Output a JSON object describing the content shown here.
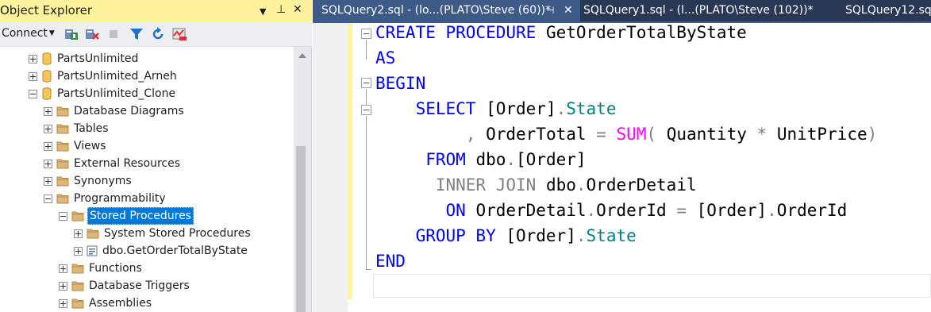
{
  "object_explorer": {
    "title": "Object Explorer",
    "title_controls": {
      "dropdown": "▼",
      "pin": "⊥",
      "close": "✕"
    },
    "toolbar": {
      "connect_label": "Connect",
      "icons": [
        "connect-icon",
        "disconnect-icon",
        "stop-icon",
        "filter-icon",
        "refresh-icon",
        "activity-monitor-icon"
      ]
    },
    "tree": [
      {
        "label": "PartsUnlimited",
        "expander": "plus",
        "icon": "database-icon"
      },
      {
        "label": "PartsUnlimited_Arneh",
        "expander": "plus",
        "icon": "database-icon"
      },
      {
        "label": "PartsUnlimited_Clone",
        "expander": "minus",
        "icon": "database-icon"
      },
      {
        "label": "Database Diagrams",
        "expander": "plus",
        "icon": "folder-icon"
      },
      {
        "label": "Tables",
        "expander": "plus",
        "icon": "folder-icon"
      },
      {
        "label": "Views",
        "expander": "plus",
        "icon": "folder-icon"
      },
      {
        "label": "External Resources",
        "expander": "plus",
        "icon": "folder-icon"
      },
      {
        "label": "Synonyms",
        "expander": "plus",
        "icon": "folder-icon"
      },
      {
        "label": "Programmability",
        "expander": "minus",
        "icon": "folder-icon"
      },
      {
        "label": "Stored Procedures",
        "expander": "minus",
        "icon": "folder-icon",
        "selected": true
      },
      {
        "label": "System Stored Procedures",
        "expander": "plus",
        "icon": "folder-icon"
      },
      {
        "label": "dbo.GetOrderTotalByState",
        "expander": "plus",
        "icon": "stored-procedure-icon"
      },
      {
        "label": "Functions",
        "expander": "plus",
        "icon": "folder-icon"
      },
      {
        "label": "Database Triggers",
        "expander": "plus",
        "icon": "folder-icon"
      },
      {
        "label": "Assemblies",
        "expander": "plus",
        "icon": "folder-icon"
      }
    ]
  },
  "tabs": [
    {
      "label": "SQLQuery2.sql - (lo...(PLATO\\Steve (60))*",
      "active": true,
      "pin": "⊣",
      "close": "✕"
    },
    {
      "label": "SQLQuery1.sql - (l...(PLATO\\Steve (102))*",
      "active": false
    },
    {
      "label": "SQLQuery12.sql",
      "active": false
    }
  ],
  "editor": {
    "lines": [
      [
        {
          "t": "CREATE PROCEDURE",
          "c": "kw"
        },
        {
          "t": " GetOrderTotalByState",
          "c": ""
        }
      ],
      [
        {
          "t": "AS",
          "c": "kw"
        }
      ],
      [
        {
          "t": "BEGIN",
          "c": "kw"
        }
      ],
      [
        {
          "t": "    SELECT",
          "c": "kw"
        },
        {
          "t": " [Order]",
          "c": ""
        },
        {
          "t": ".",
          "c": "gr"
        },
        {
          "t": "State",
          "c": "tl"
        }
      ],
      [
        {
          "t": "         ",
          "c": ""
        },
        {
          "t": ",",
          "c": "gr"
        },
        {
          "t": " OrderTotal ",
          "c": ""
        },
        {
          "t": "=",
          "c": "gr"
        },
        {
          "t": " ",
          "c": ""
        },
        {
          "t": "SUM",
          "c": "fn"
        },
        {
          "t": "(",
          "c": "gr"
        },
        {
          "t": " Quantity ",
          "c": ""
        },
        {
          "t": "*",
          "c": "gr"
        },
        {
          "t": " UnitPrice",
          "c": ""
        },
        {
          "t": ")",
          "c": "gr"
        }
      ],
      [
        {
          "t": "     FROM",
          "c": "kw"
        },
        {
          "t": " dbo",
          "c": ""
        },
        {
          "t": ".",
          "c": "gr"
        },
        {
          "t": "[Order]",
          "c": ""
        }
      ],
      [
        {
          "t": "      INNER JOIN",
          "c": "gr"
        },
        {
          "t": " dbo",
          "c": ""
        },
        {
          "t": ".",
          "c": "gr"
        },
        {
          "t": "OrderDetail",
          "c": ""
        }
      ],
      [
        {
          "t": "       ON",
          "c": "kw"
        },
        {
          "t": " OrderDetail",
          "c": ""
        },
        {
          "t": ".",
          "c": "gr"
        },
        {
          "t": "OrderId ",
          "c": ""
        },
        {
          "t": "=",
          "c": "gr"
        },
        {
          "t": " [Order]",
          "c": ""
        },
        {
          "t": ".",
          "c": "gr"
        },
        {
          "t": "OrderId",
          "c": ""
        }
      ],
      [
        {
          "t": "    GROUP BY",
          "c": "kw"
        },
        {
          "t": " [Order]",
          "c": ""
        },
        {
          "t": ".",
          "c": "gr"
        },
        {
          "t": "State",
          "c": "tl"
        }
      ],
      [
        {
          "t": "END",
          "c": "kw"
        }
      ],
      []
    ]
  },
  "colors": {
    "keyword": "#0000ff",
    "operator": "#808080",
    "function": "#ff00ff",
    "column": "#008080",
    "selection": "#0078d7",
    "title_bar": "#fff29d",
    "tab_strip": "#293955"
  }
}
